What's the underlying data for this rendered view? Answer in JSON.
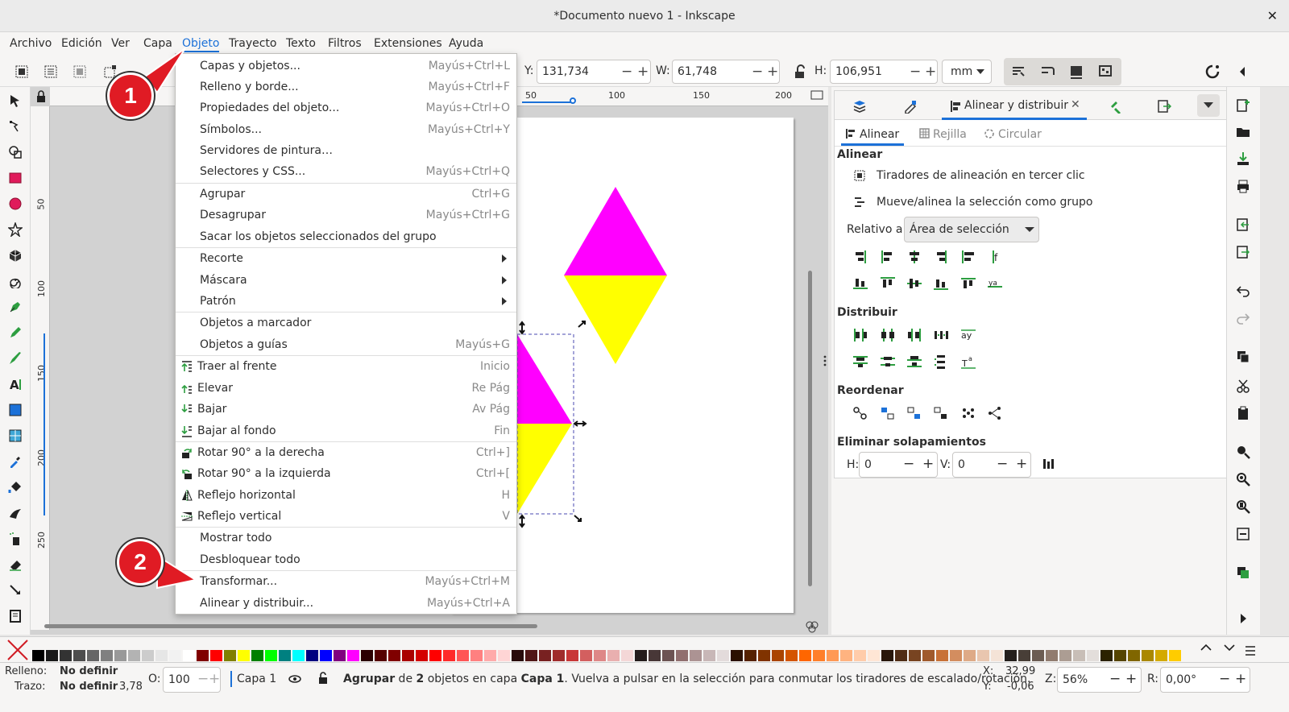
{
  "window": {
    "title": "*Documento nuevo 1 - Inkscape",
    "close": "✕"
  },
  "menubar": [
    "Archivo",
    "Edición",
    "Ver",
    "Capa",
    "Objeto",
    "Trayecto",
    "Texto",
    "Filtros",
    "Extensiones",
    "Ayuda"
  ],
  "toolbar": {
    "y_label": "Y:",
    "y_value": "131,734",
    "w_label": "W:",
    "w_value": "61,748",
    "h_label": "H:",
    "h_value": "106,951",
    "unit": "mm"
  },
  "ruler": {
    "h_ticks": [
      "50",
      "100",
      "150",
      "200"
    ],
    "v_ticks": [
      "50",
      "100",
      "150",
      "200",
      "250"
    ]
  },
  "object_menu": [
    {
      "label": "Capas y objetos...",
      "shortcut": "Mayús+Ctrl+L"
    },
    {
      "label": "Relleno y borde...",
      "shortcut": "Mayús+Ctrl+F"
    },
    {
      "label": "Propiedades del objeto...",
      "shortcut": "Mayús+Ctrl+O"
    },
    {
      "label": "Símbolos...",
      "shortcut": "Mayús+Ctrl+Y"
    },
    {
      "label": "Servidores de pintura…",
      "shortcut": ""
    },
    {
      "label": "Selectores y CSS...",
      "shortcut": "Mayús+Ctrl+Q"
    },
    {
      "label": "Agrupar",
      "shortcut": "Ctrl+G"
    },
    {
      "label": "Desagrupar",
      "shortcut": "Mayús+Ctrl+G"
    },
    {
      "label": "Sacar los objetos seleccionados del grupo",
      "shortcut": ""
    },
    {
      "label": "Recorte",
      "shortcut": ""
    },
    {
      "label": "Máscara",
      "shortcut": ""
    },
    {
      "label": "Patrón",
      "shortcut": ""
    },
    {
      "label": "Objetos a marcador",
      "shortcut": ""
    },
    {
      "label": "Objetos a guías",
      "shortcut": "Mayús+G"
    },
    {
      "label": "Traer al frente",
      "shortcut": "Inicio"
    },
    {
      "label": "Elevar",
      "shortcut": "Re Pág"
    },
    {
      "label": "Bajar",
      "shortcut": "Av Pág"
    },
    {
      "label": "Bajar al fondo",
      "shortcut": "Fin"
    },
    {
      "label": "Rotar 90° a la derecha",
      "shortcut": "Ctrl+]"
    },
    {
      "label": "Rotar 90° a la izquierda",
      "shortcut": "Ctrl+["
    },
    {
      "label": "Reflejo horizontal",
      "shortcut": "H"
    },
    {
      "label": "Reflejo vertical",
      "shortcut": "V"
    },
    {
      "label": "Mostrar todo",
      "shortcut": ""
    },
    {
      "label": "Desbloquear todo",
      "shortcut": ""
    },
    {
      "label": "Transformar...",
      "shortcut": "Mayús+Ctrl+M"
    },
    {
      "label": "Alinear y distribuir...",
      "shortcut": "Mayús+Ctrl+A"
    }
  ],
  "callouts": [
    "1",
    "2"
  ],
  "dock": {
    "active_tab": "Alinear y distribuir",
    "subtabs": [
      "Alinear",
      "Rejilla",
      "Circular"
    ],
    "align_title": "Alinear",
    "opt1": "Tiradores de alineación en tercer clic",
    "opt2": "Mueve/alinea la selección como grupo",
    "relative_label": "Relativo a:",
    "relative_value": "Área de selección",
    "distribute_title": "Distribuir",
    "reorder_title": "Reordenar",
    "overlap_title": "Eliminar solapamientos",
    "h_label": "H:",
    "h_value": "0",
    "v_label": "V:",
    "v_value": "0"
  },
  "status": {
    "fill_label": "Relleno:",
    "fill_value": "No definir",
    "stroke_label": "Trazo:",
    "stroke_value": "No definir",
    "stroke_width": "3,78",
    "opacity_label": "O:",
    "opacity_value": "100",
    "layer": "Capa 1",
    "message_pre": "Agrupar",
    "message_mid1": " de ",
    "message_count": "2",
    "message_mid2": " objetos en capa ",
    "message_layer": "Capa 1",
    "message_post": ". Vuelva a pulsar en la selección para conmutar los tiradores de escalado/rotación.",
    "x_label": "X:",
    "x_value": "32,99",
    "y_label": "Y:",
    "y_value": "-0,06",
    "zoom_label": "Z:",
    "zoom_value": "56%",
    "rot_label": "R:",
    "rot_value": "0,00°"
  },
  "colors": {
    "accent": "#1c71d8",
    "magenta": "#ff00ff",
    "yellow": "#ffff00",
    "callout": "#e01b24"
  },
  "palette": [
    "#000000",
    "#1a1a1a",
    "#333333",
    "#4d4d4d",
    "#666666",
    "#808080",
    "#999999",
    "#b3b3b3",
    "#cccccc",
    "#e6e6e6",
    "#f2f2f2",
    "#ffffff",
    "#800000",
    "#ff0000",
    "#808000",
    "#ffff00",
    "#008000",
    "#00ff00",
    "#008080",
    "#00ffff",
    "#000080",
    "#0000ff",
    "#800080",
    "#ff00ff",
    "#2b0000",
    "#550000",
    "#800000",
    "#aa0000",
    "#d40000",
    "#ff0000",
    "#ff2a2a",
    "#ff5555",
    "#ff8080",
    "#ffaaaa",
    "#ffd5d5",
    "#280b0b",
    "#501616",
    "#782121",
    "#a02c2c",
    "#c83737",
    "#d35f5f",
    "#de8787",
    "#e9afaf",
    "#f4d7d7",
    "#241c1c",
    "#483737",
    "#6c5353",
    "#916f6f",
    "#ac9393",
    "#c8b7b7",
    "#e3dbdb",
    "#2b1100",
    "#552200",
    "#803300",
    "#aa4400",
    "#d45500",
    "#ff6600",
    "#ff7f2a",
    "#ff9955",
    "#ffb380",
    "#ffccaa",
    "#ffe6d5",
    "#28170b",
    "#502d16",
    "#784421",
    "#a05a2c",
    "#c87137",
    "#d38d5f",
    "#deaa87",
    "#e9c6af",
    "#f4e3d7",
    "#241f1c",
    "#483e37",
    "#6c5d53",
    "#917c6f",
    "#ac9d93",
    "#c8beb7",
    "#e3dedb",
    "#2b2200",
    "#554400",
    "#806600",
    "#aa8800",
    "#d4aa00",
    "#ffcc00"
  ]
}
